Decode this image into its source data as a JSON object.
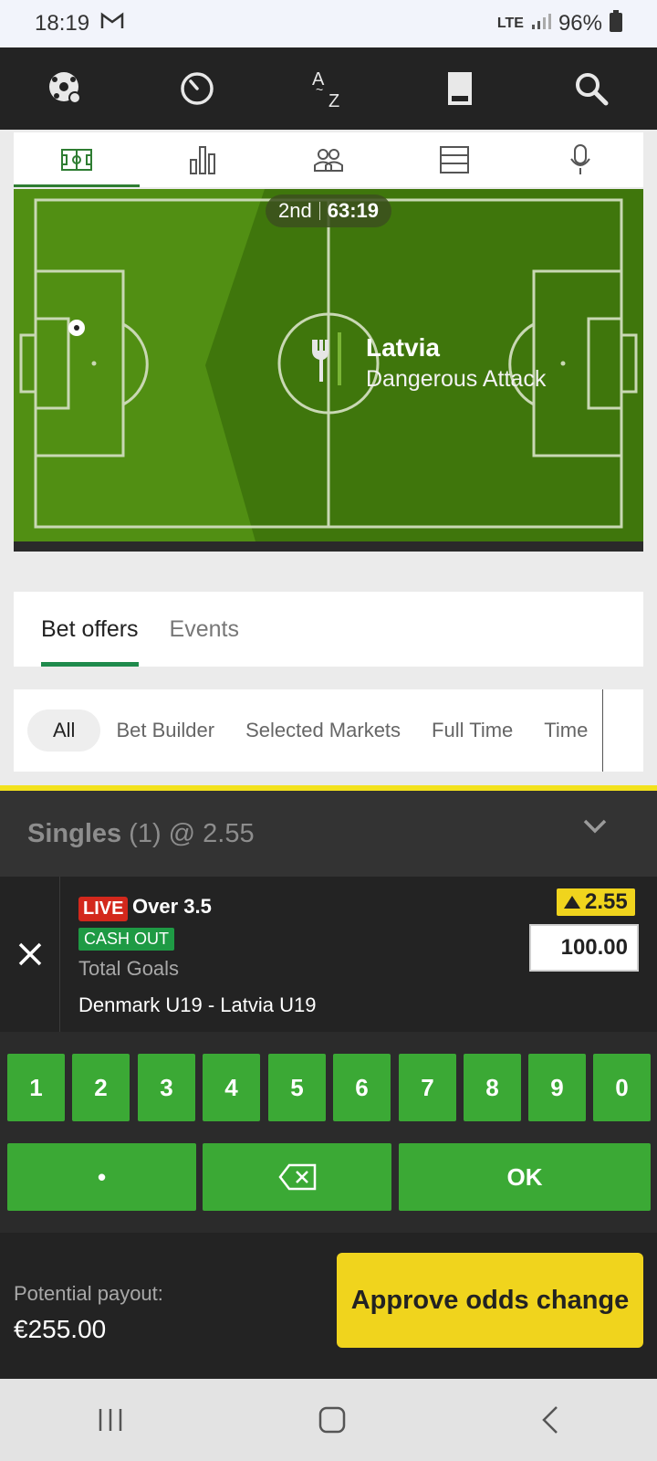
{
  "status_bar": {
    "time": "18:19",
    "network": "LTE",
    "battery": "96%"
  },
  "top_nav": {
    "icons": [
      "soccer-ball-icon",
      "clock-icon",
      "a-to-z-icon",
      "betslip-icon",
      "search-icon"
    ]
  },
  "sub_tabs": {
    "icons": [
      "pitch-icon",
      "stats-icon",
      "lineups-icon",
      "list-icon",
      "commentary-mic-icon"
    ],
    "active_index": 0
  },
  "pitch": {
    "period": "2nd",
    "clock": "63:19",
    "team": "Latvia",
    "action": "Dangerous Attack"
  },
  "offer_tabs": [
    {
      "label": "Bet offers",
      "active": true
    },
    {
      "label": "Events",
      "active": false
    }
  ],
  "filters": [
    "All",
    "Bet Builder",
    "Selected Markets",
    "Full Time",
    "Time"
  ],
  "betslip": {
    "singles_label": "Singles",
    "summary": "(1) @ 2.55",
    "bet": {
      "live_label": "LIVE",
      "selection": "Over 3.5",
      "cashout_label": "CASH OUT",
      "market": "Total Goals",
      "match": "Denmark U19 - Latvia U19",
      "odds": "2.55",
      "stake": "100.00"
    }
  },
  "keypad": {
    "digits": [
      "1",
      "2",
      "3",
      "4",
      "5",
      "6",
      "7",
      "8",
      "9",
      "0"
    ],
    "dot": "•",
    "ok": "OK"
  },
  "footer": {
    "payout_label": "Potential payout:",
    "payout_value": "€255.00",
    "approve_label": "Approve odds change"
  },
  "colors": {
    "accent_green": "#3ba935",
    "pitch_green": "#4f8f12",
    "odds_yellow": "#f0d41d",
    "live_red": "#d3281c"
  }
}
